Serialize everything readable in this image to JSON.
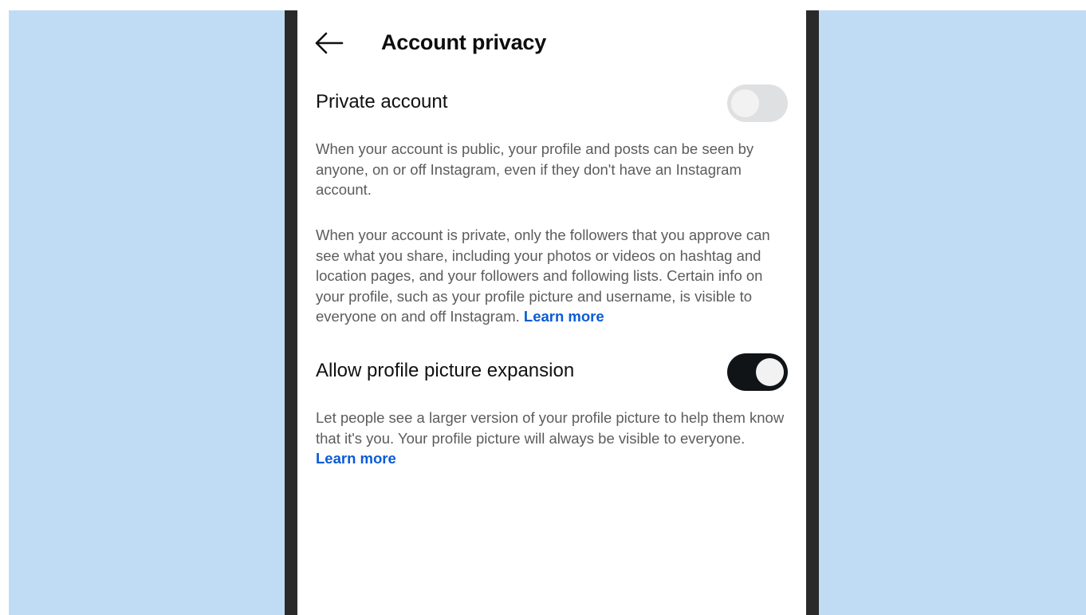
{
  "header": {
    "title": "Account privacy",
    "back_icon": "arrow-left-icon"
  },
  "private_account": {
    "label": "Private account",
    "enabled": false,
    "public_description": "When your account is public, your profile and posts can be seen by anyone, on or off Instagram, even if they don't have an Instagram account.",
    "private_description": "When your account is private, only the followers that you approve can see what you share, including your photos or videos on hashtag and location pages, and your followers and following lists. Certain info on your profile, such as your profile picture and username, is visible to everyone on and off Instagram.",
    "learn_more": "Learn more"
  },
  "profile_picture_expansion": {
    "label": "Allow profile picture expansion",
    "enabled": true,
    "description": "Let people see a larger version of your profile picture to help them know that it's you. Your profile picture will always be visible to everyone.",
    "learn_more": "Learn more"
  },
  "colors": {
    "background": "#c0dcf5",
    "link": "#0a5bd6",
    "toggle_on": "#111417",
    "toggle_off": "#dfe0e2"
  }
}
